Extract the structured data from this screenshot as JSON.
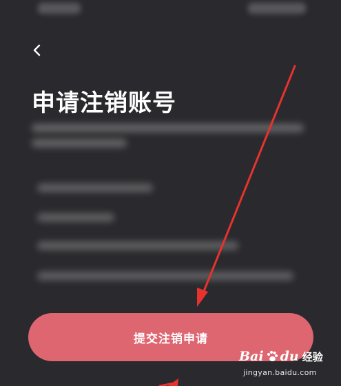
{
  "header": {
    "back_icon": "chevron-left-icon"
  },
  "page": {
    "title": "申请注销账号"
  },
  "submit": {
    "label": "提交注销申请"
  },
  "watermark": {
    "brand_left": "Bai",
    "brand_right": "du",
    "product": "经验",
    "url": "jingyan.baidu.com"
  },
  "colors": {
    "background": "#2a2a2e",
    "button": "#dd6670",
    "arrow": "#e8322e"
  }
}
